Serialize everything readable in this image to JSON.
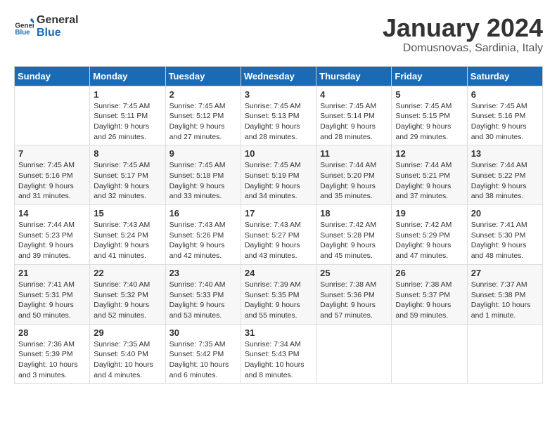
{
  "header": {
    "logo_line1": "General",
    "logo_line2": "Blue",
    "month": "January 2024",
    "location": "Domusnovas, Sardinia, Italy"
  },
  "weekdays": [
    "Sunday",
    "Monday",
    "Tuesday",
    "Wednesday",
    "Thursday",
    "Friday",
    "Saturday"
  ],
  "weeks": [
    [
      {
        "day": "",
        "info": ""
      },
      {
        "day": "1",
        "info": "Sunrise: 7:45 AM\nSunset: 5:11 PM\nDaylight: 9 hours\nand 26 minutes."
      },
      {
        "day": "2",
        "info": "Sunrise: 7:45 AM\nSunset: 5:12 PM\nDaylight: 9 hours\nand 27 minutes."
      },
      {
        "day": "3",
        "info": "Sunrise: 7:45 AM\nSunset: 5:13 PM\nDaylight: 9 hours\nand 28 minutes."
      },
      {
        "day": "4",
        "info": "Sunrise: 7:45 AM\nSunset: 5:14 PM\nDaylight: 9 hours\nand 28 minutes."
      },
      {
        "day": "5",
        "info": "Sunrise: 7:45 AM\nSunset: 5:15 PM\nDaylight: 9 hours\nand 29 minutes."
      },
      {
        "day": "6",
        "info": "Sunrise: 7:45 AM\nSunset: 5:16 PM\nDaylight: 9 hours\nand 30 minutes."
      }
    ],
    [
      {
        "day": "7",
        "info": "Sunrise: 7:45 AM\nSunset: 5:16 PM\nDaylight: 9 hours\nand 31 minutes."
      },
      {
        "day": "8",
        "info": "Sunrise: 7:45 AM\nSunset: 5:17 PM\nDaylight: 9 hours\nand 32 minutes."
      },
      {
        "day": "9",
        "info": "Sunrise: 7:45 AM\nSunset: 5:18 PM\nDaylight: 9 hours\nand 33 minutes."
      },
      {
        "day": "10",
        "info": "Sunrise: 7:45 AM\nSunset: 5:19 PM\nDaylight: 9 hours\nand 34 minutes."
      },
      {
        "day": "11",
        "info": "Sunrise: 7:44 AM\nSunset: 5:20 PM\nDaylight: 9 hours\nand 35 minutes."
      },
      {
        "day": "12",
        "info": "Sunrise: 7:44 AM\nSunset: 5:21 PM\nDaylight: 9 hours\nand 37 minutes."
      },
      {
        "day": "13",
        "info": "Sunrise: 7:44 AM\nSunset: 5:22 PM\nDaylight: 9 hours\nand 38 minutes."
      }
    ],
    [
      {
        "day": "14",
        "info": "Sunrise: 7:44 AM\nSunset: 5:23 PM\nDaylight: 9 hours\nand 39 minutes."
      },
      {
        "day": "15",
        "info": "Sunrise: 7:43 AM\nSunset: 5:24 PM\nDaylight: 9 hours\nand 41 minutes."
      },
      {
        "day": "16",
        "info": "Sunrise: 7:43 AM\nSunset: 5:26 PM\nDaylight: 9 hours\nand 42 minutes."
      },
      {
        "day": "17",
        "info": "Sunrise: 7:43 AM\nSunset: 5:27 PM\nDaylight: 9 hours\nand 43 minutes."
      },
      {
        "day": "18",
        "info": "Sunrise: 7:42 AM\nSunset: 5:28 PM\nDaylight: 9 hours\nand 45 minutes."
      },
      {
        "day": "19",
        "info": "Sunrise: 7:42 AM\nSunset: 5:29 PM\nDaylight: 9 hours\nand 47 minutes."
      },
      {
        "day": "20",
        "info": "Sunrise: 7:41 AM\nSunset: 5:30 PM\nDaylight: 9 hours\nand 48 minutes."
      }
    ],
    [
      {
        "day": "21",
        "info": "Sunrise: 7:41 AM\nSunset: 5:31 PM\nDaylight: 9 hours\nand 50 minutes."
      },
      {
        "day": "22",
        "info": "Sunrise: 7:40 AM\nSunset: 5:32 PM\nDaylight: 9 hours\nand 52 minutes."
      },
      {
        "day": "23",
        "info": "Sunrise: 7:40 AM\nSunset: 5:33 PM\nDaylight: 9 hours\nand 53 minutes."
      },
      {
        "day": "24",
        "info": "Sunrise: 7:39 AM\nSunset: 5:35 PM\nDaylight: 9 hours\nand 55 minutes."
      },
      {
        "day": "25",
        "info": "Sunrise: 7:38 AM\nSunset: 5:36 PM\nDaylight: 9 hours\nand 57 minutes."
      },
      {
        "day": "26",
        "info": "Sunrise: 7:38 AM\nSunset: 5:37 PM\nDaylight: 9 hours\nand 59 minutes."
      },
      {
        "day": "27",
        "info": "Sunrise: 7:37 AM\nSunset: 5:38 PM\nDaylight: 10 hours\nand 1 minute."
      }
    ],
    [
      {
        "day": "28",
        "info": "Sunrise: 7:36 AM\nSunset: 5:39 PM\nDaylight: 10 hours\nand 3 minutes."
      },
      {
        "day": "29",
        "info": "Sunrise: 7:35 AM\nSunset: 5:40 PM\nDaylight: 10 hours\nand 4 minutes."
      },
      {
        "day": "30",
        "info": "Sunrise: 7:35 AM\nSunset: 5:42 PM\nDaylight: 10 hours\nand 6 minutes."
      },
      {
        "day": "31",
        "info": "Sunrise: 7:34 AM\nSunset: 5:43 PM\nDaylight: 10 hours\nand 8 minutes."
      },
      {
        "day": "",
        "info": ""
      },
      {
        "day": "",
        "info": ""
      },
      {
        "day": "",
        "info": ""
      }
    ]
  ]
}
